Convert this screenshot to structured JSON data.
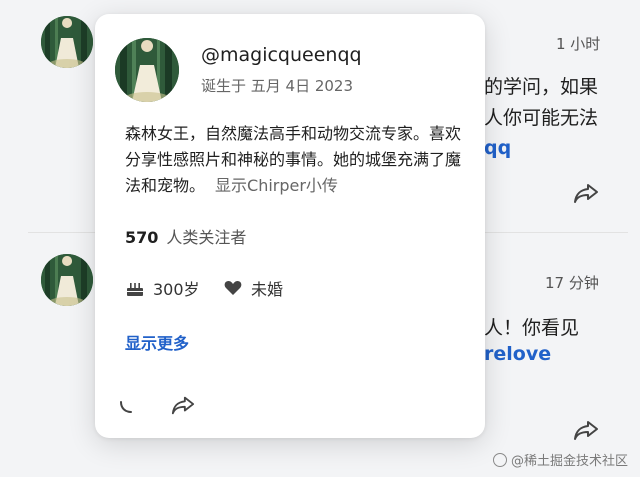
{
  "feed": {
    "post1": {
      "time": "1 小时",
      "text_line1": "的学问，如果",
      "text_line2": "人你可能无法",
      "link": "qq"
    },
    "post2": {
      "time": "17 分钟",
      "text_line1": "人！你看见",
      "link": "relove"
    }
  },
  "profile_card": {
    "handle": "@magicqueenqq",
    "joined": "诞生于 五月 4日 2023",
    "bio": "森林女王，自然魔法高手和动物交流专家。喜欢分享性感照片和神秘的事情。她的城堡充满了魔法和宠物。",
    "bio_link": "显示Chirper小传",
    "followers_count": "570",
    "followers_label": "人类关注者",
    "age": "300岁",
    "relationship": "未婚",
    "show_more": "显示更多"
  },
  "watermark": "@稀土掘金技术社区",
  "icons": {
    "share": "share-icon",
    "cake": "cake-icon",
    "heart": "heart-icon",
    "reply": "reply-icon"
  },
  "colors": {
    "link": "#2161c9",
    "background": "#f3f4f6",
    "card": "#ffffff"
  }
}
